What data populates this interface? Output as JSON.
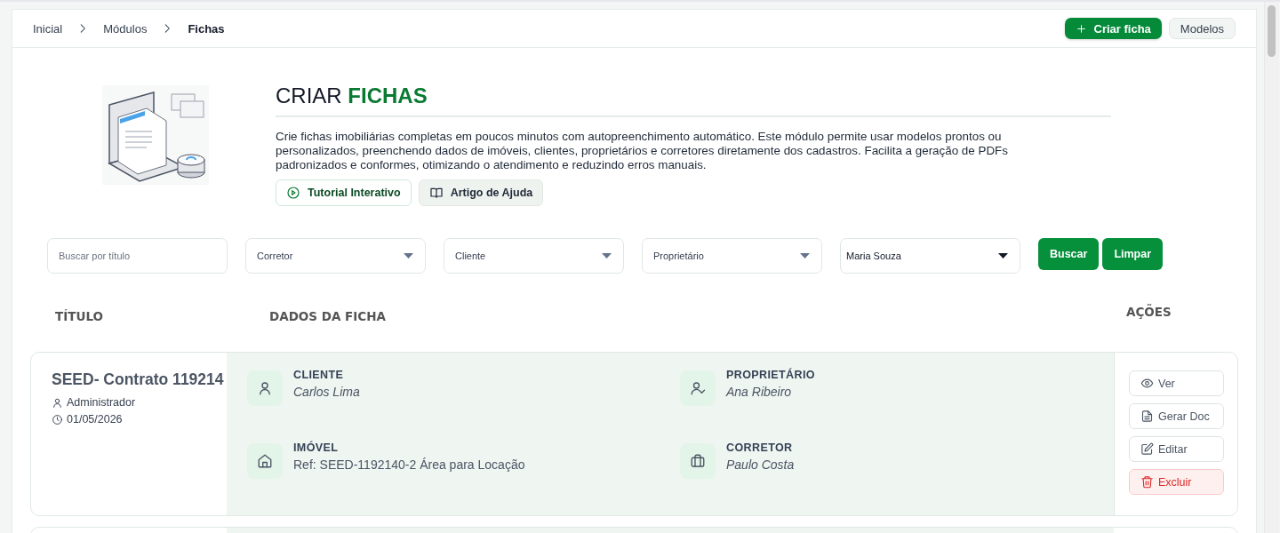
{
  "breadcrumb": [
    {
      "label": "Inicial",
      "current": false
    },
    {
      "label": "Módulos",
      "current": false
    },
    {
      "label": "Fichas",
      "current": true
    }
  ],
  "header_actions": [
    {
      "label": "Criar ficha",
      "kind": "primary"
    },
    {
      "label": "Modelos",
      "kind": "secondary"
    }
  ],
  "hero": {
    "title": "CRIAR",
    "title_highlight": "FICHAS",
    "description": "Crie fichas imobiliárias completas em poucos minutos com autopreenchimento automático. Este módulo permite usar modelos prontos ou personalizados, preenchendo dados de imóveis, clientes, proprietários e corretores diretamente dos cadastros. Facilita a geração de PDFs padronizados e conformes, otimizando o atendimento e reduzindo erros manuais.",
    "buttons": [
      {
        "label": "Tutorial Interativo",
        "kind": "tutorial"
      },
      {
        "label": "Artigo de Ajuda",
        "kind": "article"
      }
    ]
  },
  "filters": [
    {
      "kind": "search",
      "placeholder": "Buscar por título"
    },
    {
      "kind": "select",
      "placeholder": "Corretor"
    },
    {
      "kind": "select",
      "placeholder": "Cliente"
    },
    {
      "kind": "select",
      "placeholder": "Proprietário"
    },
    {
      "kind": "select",
      "value": "Maria Souza"
    }
  ],
  "filter_buttons": [
    "Buscar",
    "Limpar"
  ],
  "table": {
    "columns": [
      "TÍTULO",
      "DADOS DA FICHA",
      "AÇÕES"
    ],
    "rows": [
      {
        "title": "SEED- Contrato 119214",
        "author": "Administrador",
        "date": "01/05/2026",
        "fields": [
          {
            "kind": "client",
            "label": "CLIENTE",
            "value": "Carlos Lima"
          },
          {
            "kind": "owner",
            "label": "PROPRIETÁRIO",
            "value": "Ana Ribeiro"
          },
          {
            "kind": "property",
            "label": "IMÓVEL",
            "value": "Ref: SEED-1192140-2 Área para Locação"
          },
          {
            "kind": "broker",
            "label": "CORRETOR",
            "value": "Paulo Costa"
          }
        ],
        "actions": [
          {
            "kind": "view",
            "label": "Ver"
          },
          {
            "kind": "doc",
            "label": "Gerar Doc"
          },
          {
            "kind": "edit",
            "label": "Editar"
          },
          {
            "kind": "delete",
            "label": "Excluir"
          }
        ]
      }
    ]
  }
}
